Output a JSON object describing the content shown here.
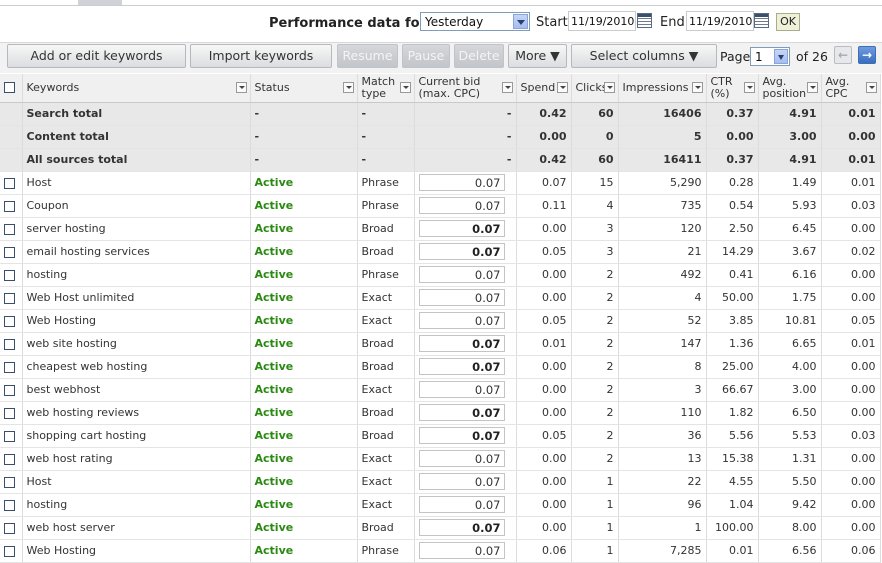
{
  "performance": {
    "label": "Performance data for:",
    "range": "Yesterday",
    "start_label": "Start",
    "start_date": "11/19/2010",
    "end_label": "End",
    "end_date": "11/19/2010",
    "ok": "OK"
  },
  "toolbar": {
    "add_edit": "Add or edit keywords",
    "import": "Import keywords",
    "resume": "Resume",
    "pause": "Pause",
    "delete": "Delete",
    "more": "More ▼",
    "select_columns": "Select columns ▼",
    "page_label": "Page",
    "page_value": "1",
    "of_pages": "of 26"
  },
  "columns": {
    "keywords": "Keywords",
    "status": "Status",
    "match_type_1": "Match",
    "match_type_2": "type",
    "bid_1": "Current bid",
    "bid_2": "(max. CPC)",
    "spend": "Spend",
    "clicks": "Clicks",
    "impressions": "Impressions",
    "ctr_1": "CTR",
    "ctr_2": "(%)",
    "avg_pos_1": "Avg.",
    "avg_pos_2": "position",
    "avg_cpc_1": "Avg.",
    "avg_cpc_2": "CPC"
  },
  "summary": [
    {
      "name": "Search total",
      "status": "-",
      "match": "-",
      "bid": "-",
      "spend": "0.42",
      "clicks": "60",
      "impressions": "16406",
      "ctr": "0.37",
      "avg_pos": "4.91",
      "avg_cpc": "0.01"
    },
    {
      "name": "Content total",
      "status": "-",
      "match": "-",
      "bid": "-",
      "spend": "0.00",
      "clicks": "0",
      "impressions": "5",
      "ctr": "0.00",
      "avg_pos": "3.00",
      "avg_cpc": "0.00"
    },
    {
      "name": "All sources total",
      "status": "-",
      "match": "-",
      "bid": "-",
      "spend": "0.42",
      "clicks": "60",
      "impressions": "16411",
      "ctr": "0.37",
      "avg_pos": "4.91",
      "avg_cpc": "0.01"
    }
  ],
  "rows": [
    {
      "keyword": "Host",
      "status": "Active",
      "match": "Phrase",
      "bid": "0.07",
      "bold": false,
      "spend": "0.07",
      "clicks": "15",
      "impressions": "5,290",
      "ctr": "0.28",
      "avg_pos": "1.49",
      "avg_cpc": "0.01"
    },
    {
      "keyword": "Coupon",
      "status": "Active",
      "match": "Phrase",
      "bid": "0.07",
      "bold": false,
      "spend": "0.11",
      "clicks": "4",
      "impressions": "735",
      "ctr": "0.54",
      "avg_pos": "5.93",
      "avg_cpc": "0.03"
    },
    {
      "keyword": "server hosting",
      "status": "Active",
      "match": "Broad",
      "bid": "0.07",
      "bold": true,
      "spend": "0.00",
      "clicks": "3",
      "impressions": "120",
      "ctr": "2.50",
      "avg_pos": "6.45",
      "avg_cpc": "0.00"
    },
    {
      "keyword": "email hosting services",
      "status": "Active",
      "match": "Broad",
      "bid": "0.07",
      "bold": true,
      "spend": "0.05",
      "clicks": "3",
      "impressions": "21",
      "ctr": "14.29",
      "avg_pos": "3.67",
      "avg_cpc": "0.02"
    },
    {
      "keyword": "hosting",
      "status": "Active",
      "match": "Phrase",
      "bid": "0.07",
      "bold": false,
      "spend": "0.00",
      "clicks": "2",
      "impressions": "492",
      "ctr": "0.41",
      "avg_pos": "6.16",
      "avg_cpc": "0.00"
    },
    {
      "keyword": "Web Host unlimited",
      "status": "Active",
      "match": "Exact",
      "bid": "0.07",
      "bold": false,
      "spend": "0.00",
      "clicks": "2",
      "impressions": "4",
      "ctr": "50.00",
      "avg_pos": "1.75",
      "avg_cpc": "0.00"
    },
    {
      "keyword": "Web Hosting",
      "status": "Active",
      "match": "Exact",
      "bid": "0.07",
      "bold": false,
      "spend": "0.05",
      "clicks": "2",
      "impressions": "52",
      "ctr": "3.85",
      "avg_pos": "10.81",
      "avg_cpc": "0.05"
    },
    {
      "keyword": "web site hosting",
      "status": "Active",
      "match": "Broad",
      "bid": "0.07",
      "bold": true,
      "spend": "0.01",
      "clicks": "2",
      "impressions": "147",
      "ctr": "1.36",
      "avg_pos": "6.65",
      "avg_cpc": "0.01"
    },
    {
      "keyword": "cheapest web hosting",
      "status": "Active",
      "match": "Broad",
      "bid": "0.07",
      "bold": true,
      "spend": "0.00",
      "clicks": "2",
      "impressions": "8",
      "ctr": "25.00",
      "avg_pos": "4.00",
      "avg_cpc": "0.00"
    },
    {
      "keyword": "best webhost",
      "status": "Active",
      "match": "Exact",
      "bid": "0.07",
      "bold": false,
      "spend": "0.00",
      "clicks": "2",
      "impressions": "3",
      "ctr": "66.67",
      "avg_pos": "3.00",
      "avg_cpc": "0.00"
    },
    {
      "keyword": "web hosting reviews",
      "status": "Active",
      "match": "Broad",
      "bid": "0.07",
      "bold": true,
      "spend": "0.00",
      "clicks": "2",
      "impressions": "110",
      "ctr": "1.82",
      "avg_pos": "6.50",
      "avg_cpc": "0.00"
    },
    {
      "keyword": "shopping cart hosting",
      "status": "Active",
      "match": "Broad",
      "bid": "0.07",
      "bold": true,
      "spend": "0.05",
      "clicks": "2",
      "impressions": "36",
      "ctr": "5.56",
      "avg_pos": "5.53",
      "avg_cpc": "0.03"
    },
    {
      "keyword": "web host rating",
      "status": "Active",
      "match": "Exact",
      "bid": "0.07",
      "bold": false,
      "spend": "0.00",
      "clicks": "2",
      "impressions": "13",
      "ctr": "15.38",
      "avg_pos": "1.31",
      "avg_cpc": "0.00"
    },
    {
      "keyword": "Host",
      "status": "Active",
      "match": "Exact",
      "bid": "0.07",
      "bold": false,
      "spend": "0.00",
      "clicks": "1",
      "impressions": "22",
      "ctr": "4.55",
      "avg_pos": "5.50",
      "avg_cpc": "0.00"
    },
    {
      "keyword": "hosting",
      "status": "Active",
      "match": "Exact",
      "bid": "0.07",
      "bold": false,
      "spend": "0.00",
      "clicks": "1",
      "impressions": "96",
      "ctr": "1.04",
      "avg_pos": "9.42",
      "avg_cpc": "0.00"
    },
    {
      "keyword": "web host server",
      "status": "Active",
      "match": "Broad",
      "bid": "0.07",
      "bold": true,
      "spend": "0.00",
      "clicks": "1",
      "impressions": "1",
      "ctr": "100.00",
      "avg_pos": "8.00",
      "avg_cpc": "0.00"
    },
    {
      "keyword": "Web Hosting",
      "status": "Active",
      "match": "Phrase",
      "bid": "0.07",
      "bold": false,
      "spend": "0.06",
      "clicks": "1",
      "impressions": "7,285",
      "ctr": "0.01",
      "avg_pos": "6.56",
      "avg_cpc": "0.06"
    }
  ]
}
